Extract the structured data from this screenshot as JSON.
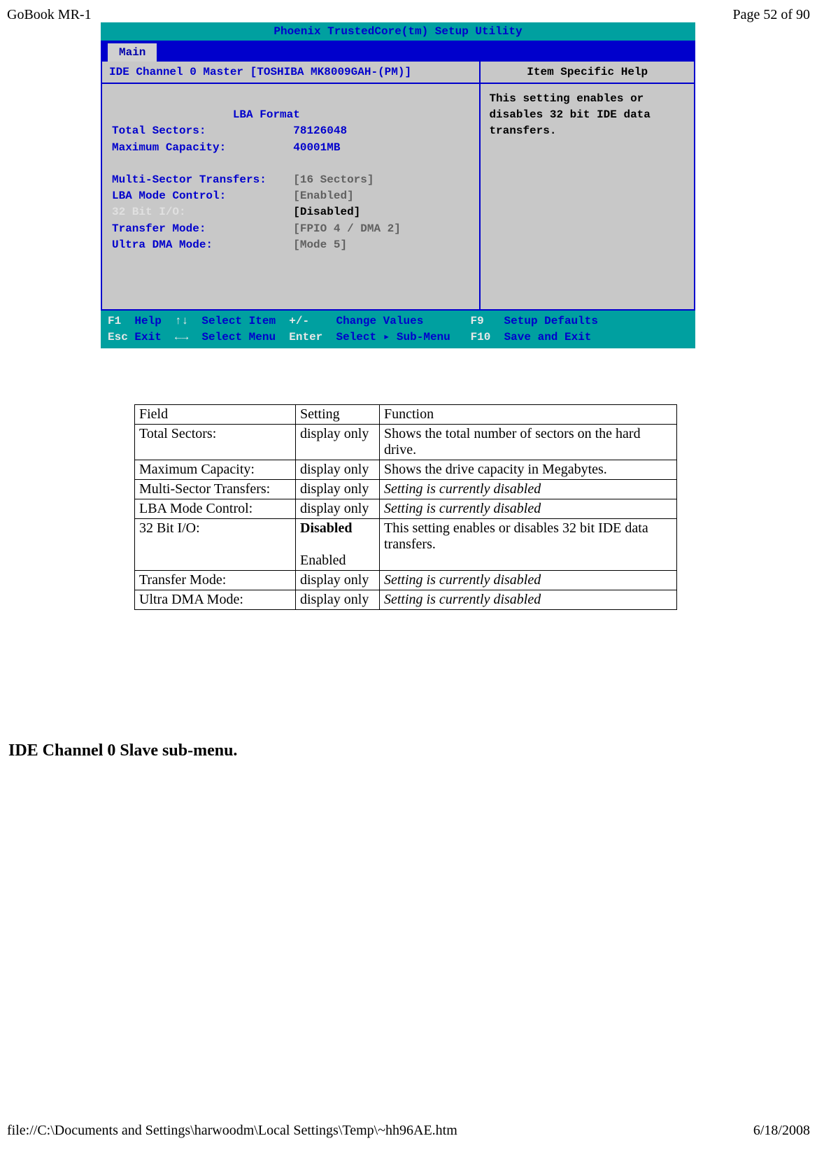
{
  "header": {
    "left": "GoBook MR-1",
    "right": "Page 52 of 90"
  },
  "bios": {
    "title": "Phoenix TrustedCore(tm) Setup Utility",
    "tab": "Main",
    "subheader": "IDE Channel 0 Master   [TOSHIBA MK8009GAH-(PM)]",
    "help_title": "Item Specific Help",
    "help_body": "This setting enables or disables 32 bit IDE data transfers.",
    "lba_heading": "LBA Format",
    "fields": {
      "total_sectors_label": "Total Sectors:",
      "total_sectors_value": "78126048",
      "max_capacity_label": "Maximum Capacity:",
      "max_capacity_value": "40001MB",
      "mst_label": "Multi-Sector Transfers:",
      "mst_value": "[16 Sectors]",
      "lba_label": "LBA Mode Control:",
      "lba_value": "[Enabled]",
      "bit32_label": "32 Bit I/O:",
      "bit32_value": "[Disabled]",
      "transfer_label": "Transfer Mode:",
      "transfer_value": "[FPIO 4 / DMA 2]",
      "ultra_label": "Ultra DMA Mode:",
      "ultra_value": "[Mode 5]"
    },
    "footer": {
      "line1_k1": "F1",
      "line1_l1": "Help",
      "line1_k2": "↑↓",
      "line1_l2": "Select Item",
      "line1_k3": "+/-",
      "line1_l3": "Change Values",
      "line1_k4": "F9",
      "line1_l4": "Setup Defaults",
      "line2_k1": "Esc",
      "line2_l1": "Exit",
      "line2_k2": "←→",
      "line2_l2": "Select Menu",
      "line2_k3": "Enter",
      "line2_l3": "Select ▸ Sub-Menu",
      "line2_k4": "F10",
      "line2_l4": "Save and Exit"
    }
  },
  "table": {
    "header": {
      "field": "Field",
      "setting": "Setting",
      "function": "Function"
    },
    "rows": [
      {
        "field": "Total Sectors:",
        "setting": "display only",
        "function": "Shows the total number of sectors on the hard drive."
      },
      {
        "field": "Maximum Capacity:",
        "setting": "display only",
        "function": "Shows the drive capacity in Megabytes."
      },
      {
        "field": "Multi-Sector Transfers:",
        "setting": "display only",
        "function_italic": "Setting is currently disabled"
      },
      {
        "field": "LBA Mode Control:",
        "setting": "display only",
        "function_italic": "Setting is currently disabled"
      },
      {
        "field": "32 Bit I/O:",
        "setting_bold": "Disabled",
        "setting2": "Enabled",
        "function": "This setting enables or disables 32 bit IDE data transfers."
      },
      {
        "field": "Transfer Mode:",
        "setting": "display only",
        "function_italic": "Setting is currently disabled"
      },
      {
        "field": "Ultra DMA Mode:",
        "setting": "display only",
        "function_italic": "Setting is currently disabled"
      }
    ]
  },
  "subheading": "IDE Channel 0 Slave sub-menu.",
  "footer": {
    "path": "file://C:\\Documents and Settings\\harwoodm\\Local Settings\\Temp\\~hh96AE.htm",
    "date": "6/18/2008"
  }
}
